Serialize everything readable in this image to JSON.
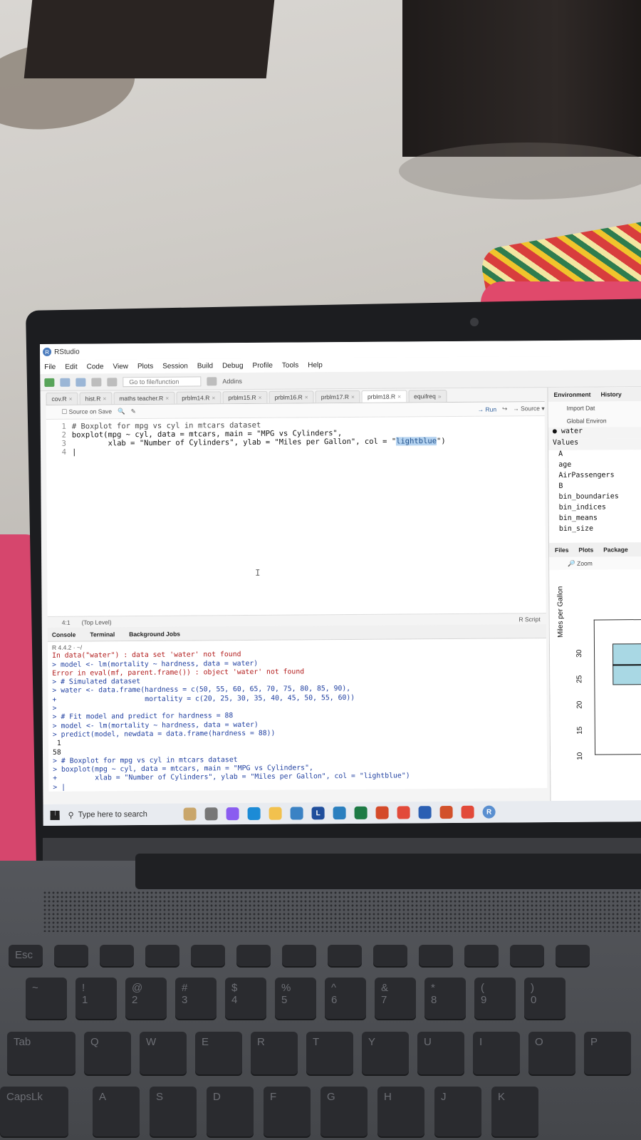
{
  "app": {
    "title": "RStudio",
    "logo": "R"
  },
  "menu": [
    "File",
    "Edit",
    "Code",
    "View",
    "Plots",
    "Session",
    "Build",
    "Debug",
    "Profile",
    "Tools",
    "Help"
  ],
  "toolbar": {
    "goto_placeholder": "Go to file/function",
    "addins": "Addins"
  },
  "editor_tabs": [
    "cov.R",
    "hist.R",
    "maths teacher.R",
    "prblm14.R",
    "prblm15.R",
    "prblm16.R",
    "prblm17.R",
    "prblm18.R",
    "equifreq"
  ],
  "editor_toolbar": {
    "source_on_save": "Source on Save",
    "run": "Run",
    "source": "Source"
  },
  "editor": {
    "lines": [
      {
        "num": "1",
        "text": "# Boxplot for mpg vs cyl in mtcars dataset"
      },
      {
        "num": "2",
        "text": "boxplot(mpg ~ cyl, data = mtcars, main = \"MPG vs Cylinders\","
      },
      {
        "num": "3",
        "text_a": "        xlab = \"Number of Cylinders\", ylab = \"Miles per Gallon\", col = \"",
        "text_hl": "lightblue",
        "text_b": "\")"
      },
      {
        "num": "4",
        "text": ""
      }
    ]
  },
  "statusbar": {
    "position": "4:1",
    "scope": "(Top Level)",
    "filetype": "R Script"
  },
  "console_tabs": [
    "Console",
    "Terminal",
    "Background Jobs"
  ],
  "console": {
    "header": "R 4.4.2 · ~/",
    "lines": [
      {
        "cls": "err",
        "text": "In data(\"water\") : data set 'water' not found"
      },
      {
        "cls": "",
        "text": "> model <- lm(mortality ~ hardness, data = water)"
      },
      {
        "cls": "err",
        "text": "Error in eval(mf, parent.frame()) : object 'water' not found"
      },
      {
        "cls": "",
        "text": "> # Simulated dataset"
      },
      {
        "cls": "",
        "text": "> water <- data.frame(hardness = c(50, 55, 60, 65, 70, 75, 80, 85, 90),"
      },
      {
        "cls": "",
        "text": "+                     mortality = c(20, 25, 30, 35, 40, 45, 50, 55, 60))"
      },
      {
        "cls": "",
        "text": ">"
      },
      {
        "cls": "",
        "text": "> # Fit model and predict for hardness = 88"
      },
      {
        "cls": "",
        "text": "> model <- lm(mortality ~ hardness, data = water)"
      },
      {
        "cls": "",
        "text": "> predict(model, newdata = data.frame(hardness = 88))"
      },
      {
        "cls": "out",
        "text": " 1"
      },
      {
        "cls": "out",
        "text": "58"
      },
      {
        "cls": "",
        "text": "> # Boxplot for mpg vs cyl in mtcars dataset"
      },
      {
        "cls": "",
        "text": "> boxplot(mpg ~ cyl, data = mtcars, main = \"MPG vs Cylinders\","
      },
      {
        "cls": "",
        "text": "+         xlab = \"Number of Cylinders\", ylab = \"Miles per Gallon\", col = \"lightblue\")"
      },
      {
        "cls": "",
        "text": "> |"
      }
    ]
  },
  "environment": {
    "tabs": [
      "Environment",
      "History"
    ],
    "import": "Import Dat",
    "scope": "Global Environ",
    "data_item": "water",
    "values_header": "Values",
    "values": [
      "A",
      "age",
      "AirPassengers",
      "B",
      "bin_boundaries",
      "bin_indices",
      "bin_means",
      "bin_size"
    ]
  },
  "files_tabs": [
    "Files",
    "Plots",
    "Package"
  ],
  "files_tools": {
    "zoom": "Zoom"
  },
  "plot": {
    "ylabel": "Miles per Gallon",
    "yticks": [
      "30",
      "25",
      "20",
      "15",
      "10"
    ],
    "box_color": "#a9d8e4"
  },
  "taskbar": {
    "search_placeholder": "Type here to search"
  },
  "keyboard": {
    "row1": [
      "Esc",
      "",
      "",
      "",
      "",
      "",
      "",
      "",
      "",
      "",
      "",
      "",
      ""
    ],
    "row2": [
      "~",
      "!\n1",
      "@\n2",
      "#\n3",
      "$\n4",
      "%\n5",
      "^\n6",
      "&\n7",
      "*\n8",
      "(\n9",
      ")\n0"
    ],
    "row3": [
      "Tab",
      "Q",
      "W",
      "E",
      "R",
      "T",
      "Y",
      "U",
      "I",
      "O",
      "P"
    ],
    "row4": [
      "CapsLk",
      "A",
      "S",
      "D",
      "F",
      "G",
      "H",
      "J",
      "K"
    ]
  }
}
